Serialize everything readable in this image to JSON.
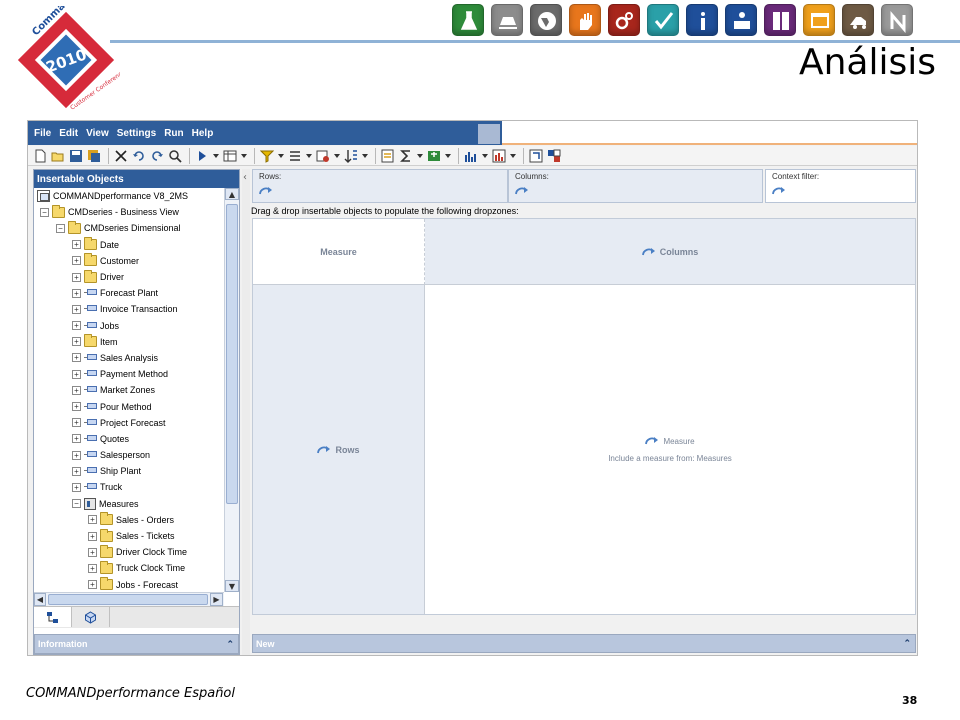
{
  "slide": {
    "title": "Análisis",
    "footer": "COMMANDperformance Español",
    "page_number": "38"
  },
  "logo": {
    "brand": "Command Alkon",
    "year": "2010",
    "subtitle": "Customer Conference"
  },
  "icon_strip": [
    {
      "name": "flask-icon",
      "color": "#2e8b3a"
    },
    {
      "name": "stack-icon",
      "color": "#8c8c8c"
    },
    {
      "name": "globe-icon",
      "color": "#6b6b6b"
    },
    {
      "name": "hand-icon",
      "color": "#e8761c"
    },
    {
      "name": "gears-icon",
      "color": "#a8261c"
    },
    {
      "name": "checkmark-icon",
      "color": "#2aa0a8"
    },
    {
      "name": "info-icon",
      "color": "#1f4f9a"
    },
    {
      "name": "person-desk-icon",
      "color": "#1f4f9a"
    },
    {
      "name": "panels-icon",
      "color": "#6a2a7a"
    },
    {
      "name": "window-icon",
      "color": "#f0a01c"
    },
    {
      "name": "truck-icon",
      "color": "#6e5a44"
    },
    {
      "name": "letter-n-icon",
      "color": "#9a9a9a"
    }
  ],
  "menu": [
    "File",
    "Edit",
    "View",
    "Settings",
    "Run",
    "Help"
  ],
  "left_panel": {
    "header": "Insertable Objects",
    "info_header": "Information"
  },
  "tree": [
    {
      "label": "COMMANDperformance V8_2MS",
      "depth": 0,
      "icon": "cube",
      "expander": ""
    },
    {
      "label": "CMDseries - Business View",
      "depth": 1,
      "icon": "folder",
      "expander": "−"
    },
    {
      "label": "CMDseries Dimensional",
      "depth": 2,
      "icon": "folder",
      "expander": "−"
    },
    {
      "label": "Date",
      "depth": 3,
      "icon": "folder",
      "expander": "+"
    },
    {
      "label": "Customer",
      "depth": 3,
      "icon": "folder",
      "expander": "+"
    },
    {
      "label": "Driver",
      "depth": 3,
      "icon": "folder",
      "expander": "+"
    },
    {
      "label": "Forecast Plant",
      "depth": 3,
      "icon": "dim",
      "expander": "+"
    },
    {
      "label": "Invoice Transaction",
      "depth": 3,
      "icon": "dim",
      "expander": "+"
    },
    {
      "label": "Jobs",
      "depth": 3,
      "icon": "dim",
      "expander": "+"
    },
    {
      "label": "Item",
      "depth": 3,
      "icon": "folder",
      "expander": "+"
    },
    {
      "label": "Sales Analysis",
      "depth": 3,
      "icon": "dim",
      "expander": "+"
    },
    {
      "label": "Payment Method",
      "depth": 3,
      "icon": "dim",
      "expander": "+"
    },
    {
      "label": "Market Zones",
      "depth": 3,
      "icon": "dim",
      "expander": "+"
    },
    {
      "label": "Pour Method",
      "depth": 3,
      "icon": "dim",
      "expander": "+"
    },
    {
      "label": "Project Forecast",
      "depth": 3,
      "icon": "dim",
      "expander": "+"
    },
    {
      "label": "Quotes",
      "depth": 3,
      "icon": "dim",
      "expander": "+"
    },
    {
      "label": "Salesperson",
      "depth": 3,
      "icon": "dim",
      "expander": "+"
    },
    {
      "label": "Ship Plant",
      "depth": 3,
      "icon": "dim",
      "expander": "+"
    },
    {
      "label": "Truck",
      "depth": 3,
      "icon": "dim",
      "expander": "+"
    },
    {
      "label": "Measures",
      "depth": 3,
      "icon": "measures",
      "expander": "−"
    },
    {
      "label": "Sales - Orders",
      "depth": 4,
      "icon": "folder",
      "expander": "+"
    },
    {
      "label": "Sales - Tickets",
      "depth": 4,
      "icon": "folder",
      "expander": "+"
    },
    {
      "label": "Driver Clock Time",
      "depth": 4,
      "icon": "folder",
      "expander": "+"
    },
    {
      "label": "Truck Clock Time",
      "depth": 4,
      "icon": "folder",
      "expander": "+"
    },
    {
      "label": "Jobs - Forecast",
      "depth": 4,
      "icon": "folder",
      "expander": "+"
    }
  ],
  "dropzones": {
    "rows": "Rows:",
    "columns": "Columns:",
    "context_filter": "Context filter:"
  },
  "instruction": "Drag & drop insertable objects to populate the following dropzones:",
  "crosstab": {
    "measure": "Measure",
    "columns": "Columns",
    "rows": "Rows",
    "data_measure": "Measure",
    "data_hint": "Include a measure from: Measures"
  },
  "new_bar": "New",
  "colors": {
    "menubar": "#2f5d9a",
    "dropzone_bg": "#e6ebf3",
    "collapsed_bar": "#b8c6dd"
  }
}
